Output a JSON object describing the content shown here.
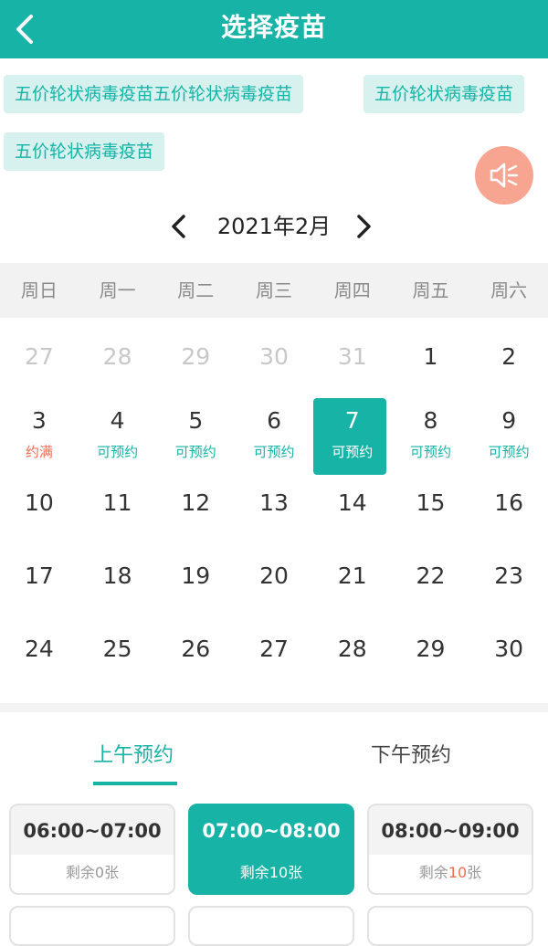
{
  "header": {
    "title": "选择疫苗"
  },
  "vaccines": [
    {
      "label": "五价轮状病毒疫苗五价轮状病毒疫苗"
    },
    {
      "label": "五价轮状病毒疫苗"
    },
    {
      "label": "五价轮状病毒疫苗"
    }
  ],
  "calendar": {
    "month_label": "2021年2月",
    "weekdays": [
      "周日",
      "周一",
      "周二",
      "周三",
      "周四",
      "周五",
      "周六"
    ],
    "weeks": [
      [
        {
          "d": "27"
        },
        {
          "d": "28"
        },
        {
          "d": "29"
        },
        {
          "d": "30"
        },
        {
          "d": "31"
        },
        {
          "d": "1"
        },
        {
          "d": "2"
        }
      ],
      [
        {
          "d": "3",
          "s": "约满"
        },
        {
          "d": "4",
          "s": "可预约"
        },
        {
          "d": "5",
          "s": "可预约"
        },
        {
          "d": "6",
          "s": "可预约"
        },
        {
          "d": "7",
          "s": "可预约"
        },
        {
          "d": "8",
          "s": "可预约"
        },
        {
          "d": "9",
          "s": "可预约"
        }
      ],
      [
        {
          "d": "10"
        },
        {
          "d": "11"
        },
        {
          "d": "12"
        },
        {
          "d": "13"
        },
        {
          "d": "14"
        },
        {
          "d": "15"
        },
        {
          "d": "16"
        }
      ],
      [
        {
          "d": "17"
        },
        {
          "d": "18"
        },
        {
          "d": "19"
        },
        {
          "d": "20"
        },
        {
          "d": "21"
        },
        {
          "d": "22"
        },
        {
          "d": "23"
        }
      ],
      [
        {
          "d": "24"
        },
        {
          "d": "25"
        },
        {
          "d": "26"
        },
        {
          "d": "27"
        },
        {
          "d": "28"
        },
        {
          "d": "29"
        },
        {
          "d": "30"
        }
      ]
    ]
  },
  "period_tabs": {
    "morning": "上午预约",
    "afternoon": "下午预约"
  },
  "slots": [
    {
      "time": "06:00~07:00",
      "remain_prefix": "剩余",
      "remain_num": "0",
      "remain_suffix": "张"
    },
    {
      "time": "07:00~08:00",
      "remain_prefix": "剩余",
      "remain_num": "10",
      "remain_suffix": "张"
    },
    {
      "time": "08:00~09:00",
      "remain_prefix": "剩余",
      "remain_num": "10",
      "remain_suffix": "张"
    }
  ],
  "colors": {
    "accent": "#17b3a6",
    "full": "#f06c51",
    "speaker": "#f7a590"
  },
  "icons": {
    "back": "chevron-left-icon",
    "speaker": "speaker-icon",
    "prev": "chevron-left-icon",
    "next": "chevron-right-icon"
  }
}
